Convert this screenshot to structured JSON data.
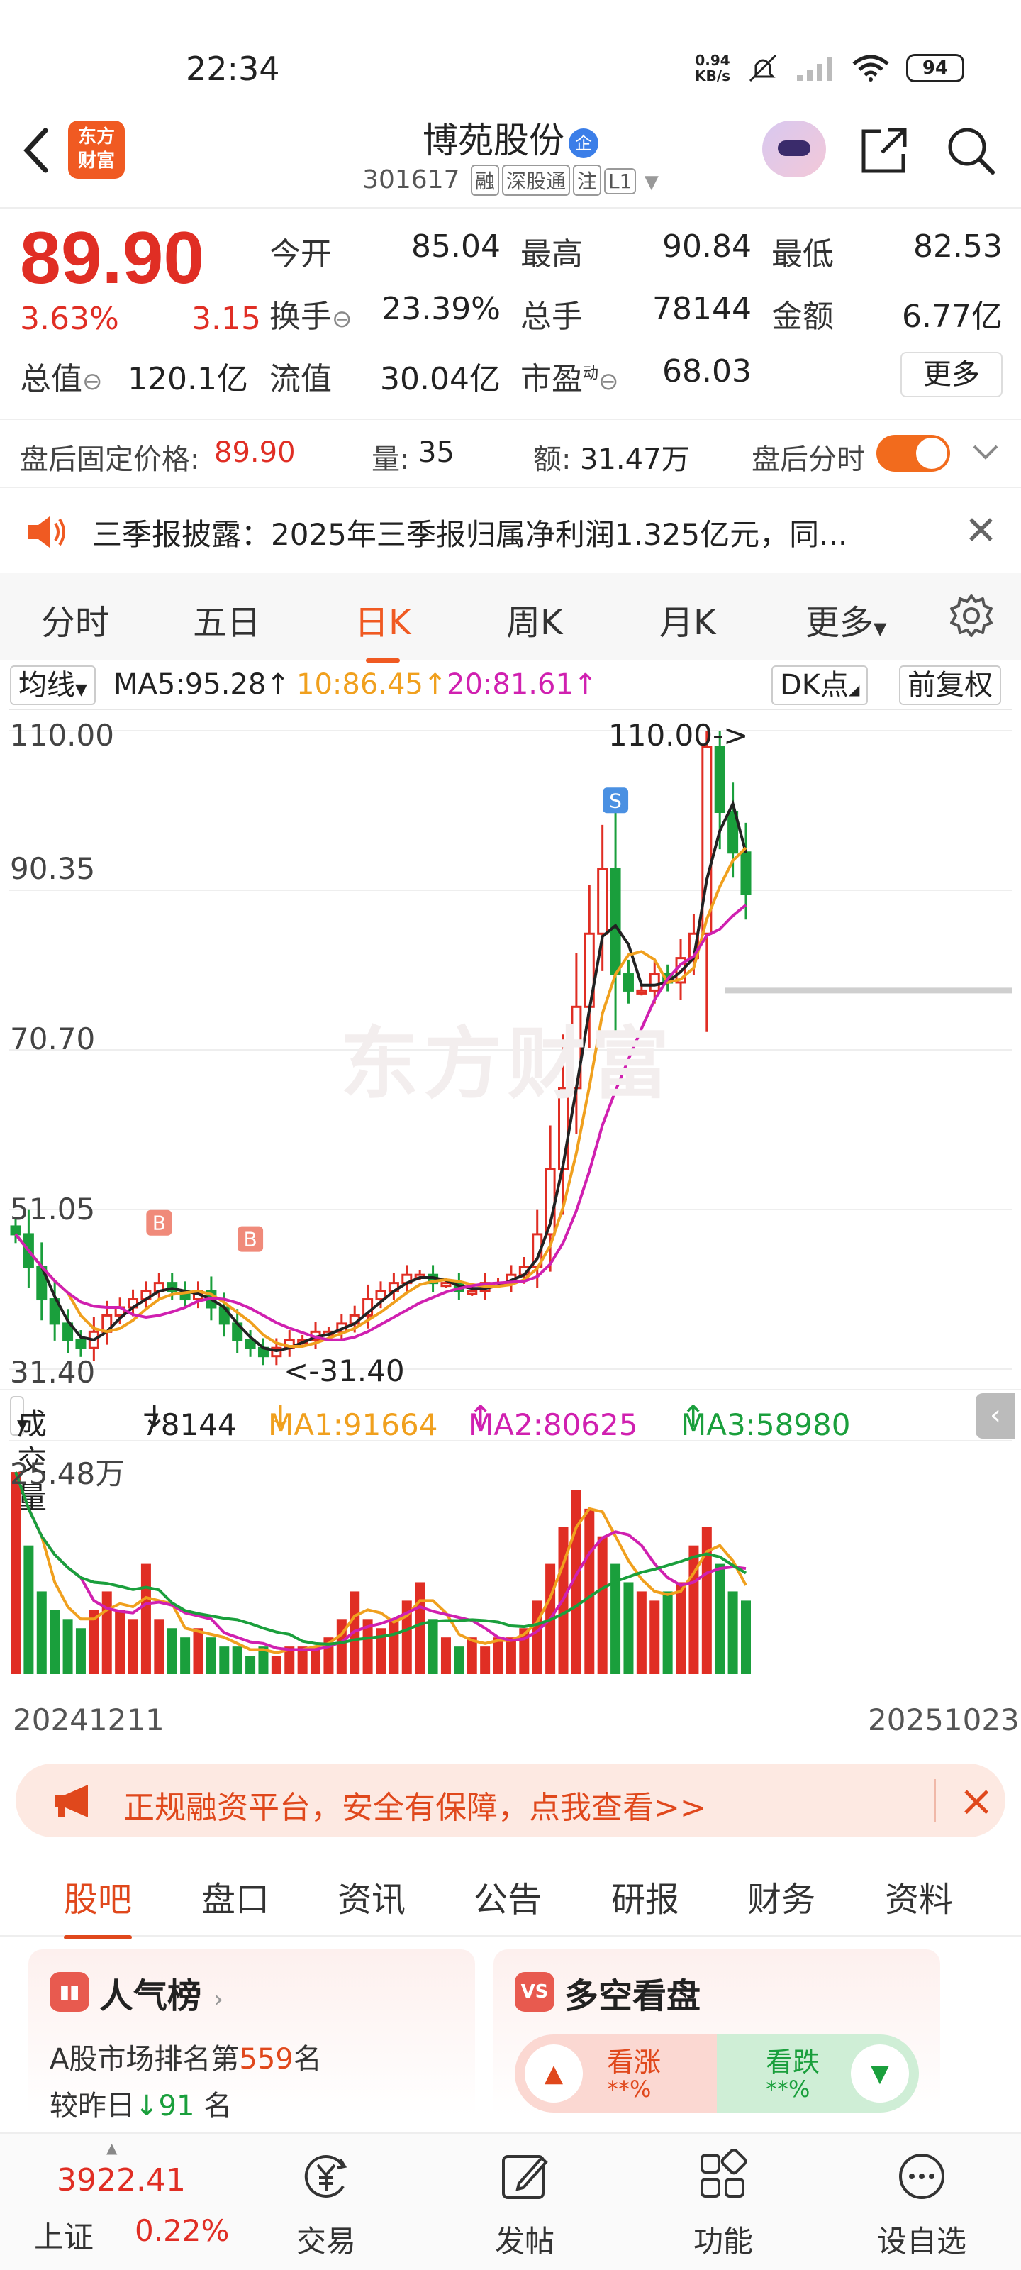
{
  "status_bar": {
    "time": "22:34",
    "net_speed_value": "0.94",
    "net_speed_unit": "KB/s",
    "battery": "94"
  },
  "header": {
    "back_icon": "chevron-left-icon",
    "logo_line1": "东方",
    "logo_line2": "财富",
    "stock_name": "博苑股份",
    "company_badge": "企",
    "stock_code": "301617",
    "tags": [
      "融",
      "深股通",
      "注",
      "L1"
    ]
  },
  "quote": {
    "price": "89.90",
    "change_pct": "3.63%",
    "change_amt": "3.15",
    "fields": [
      {
        "label": "今开",
        "value": "85.04",
        "color": "#1a9f3c"
      },
      {
        "label": "最高",
        "value": "90.84",
        "color": "#e02e24"
      },
      {
        "label": "最低",
        "value": "82.53",
        "color": "#1a9f3c"
      },
      {
        "label": "换手",
        "value": "23.39%",
        "color": "#222222"
      },
      {
        "label": "总手",
        "value": "78144",
        "color": "#222222"
      },
      {
        "label": "金额",
        "value": "6.77亿",
        "color": "#222222"
      },
      {
        "label": "总值",
        "value": "120.1亿",
        "color": "#222222"
      },
      {
        "label": "流值",
        "value": "30.04亿",
        "color": "#222222"
      },
      {
        "label": "市盈",
        "value": "68.03",
        "color": "#222222"
      }
    ],
    "pe_superscript": "动",
    "more_label": "更多"
  },
  "after_hours": {
    "price_label": "盘后固定价格:",
    "price_value": "89.90",
    "vol_label": "量:",
    "vol_value": "35",
    "amt_label": "额:",
    "amt_value": "31.47万",
    "timeshare_label": "盘后分时"
  },
  "notice": {
    "text": "三季报披露：2025年三季报归属净利润1.325亿元，同..."
  },
  "chart_tabs": [
    "分时",
    "五日",
    "日K",
    "周K",
    "月K",
    "更多"
  ],
  "ma": {
    "selector": "均线",
    "ma5": "MA5:95.28",
    "ma10": "10:86.45",
    "ma20": "20:81.61",
    "dk_label": "DK点",
    "adjust_label": "前复权",
    "colors": {
      "ma5": "#222222",
      "ma10": "#f0a01e",
      "ma20": "#d020b0"
    }
  },
  "kchart_labels": {
    "y_top": "110.00",
    "y_2": "90.35",
    "y_3": "70.70",
    "y_4": "51.05",
    "y_bottom": "31.40",
    "high_marker": "110.00->",
    "low_marker": "<-31.40",
    "watermark": "东方财富",
    "signal_b": "B",
    "signal_s": "S"
  },
  "volume": {
    "selector": "成交量",
    "value": "78144",
    "ma1": "MA1:91664",
    "ma2": "MA2:80625",
    "ma3": "MA3:58980",
    "y_top": "25.48万",
    "date_start": "20241211",
    "date_end": "20251023"
  },
  "banner": {
    "text": "正规融资平台，安全有保障，点我查看>>"
  },
  "info_tabs": [
    "股吧",
    "盘口",
    "资讯",
    "公告",
    "研报",
    "财务",
    "资料"
  ],
  "cards": {
    "popularity": {
      "title": "人气榜",
      "rank_prefix": "A股市场排名第",
      "rank": "559",
      "rank_suffix": "名",
      "change_prefix": "较昨日",
      "change": "91",
      "change_suffix": "名"
    },
    "sentiment": {
      "title": "多空看盘",
      "bull": "看涨",
      "bull_pct": "**%",
      "bear": "看跌",
      "bear_pct": "**%"
    }
  },
  "bottom_nav": {
    "index_value": "3922.41",
    "index_name": "上证",
    "index_pct": "0.22%",
    "items": [
      "交易",
      "发帖",
      "功能",
      "设自选"
    ]
  },
  "chart_data": {
    "type": "candlestick",
    "x_range": [
      "20241211",
      "20251023"
    ],
    "ylim": [
      31.4,
      110.0
    ],
    "y_ticks": [
      110.0,
      90.35,
      70.7,
      51.05,
      31.4
    ],
    "period_high": 110.0,
    "period_low": 31.4,
    "last_close": 89.9,
    "ma": {
      "MA5": 95.28,
      "MA10": 86.45,
      "MA20": 81.61
    },
    "close_trend": [
      48,
      44,
      40,
      37,
      35,
      34,
      36,
      38,
      39,
      40,
      41,
      42,
      41,
      40,
      41,
      39,
      37,
      35,
      34,
      33,
      34,
      35,
      35,
      36,
      36,
      37,
      38,
      40,
      41,
      42,
      43,
      43,
      42,
      42,
      41,
      41,
      42,
      42,
      43,
      44,
      48,
      56,
      66,
      76,
      85,
      93,
      80,
      78,
      78,
      80,
      79,
      82,
      85,
      108,
      100,
      95,
      89.9
    ],
    "volume_ylim": [
      0,
      25.48
    ],
    "volume_unit": "万",
    "volume_trend": [
      22,
      14,
      9,
      7,
      6,
      5,
      7,
      9,
      7,
      6,
      12,
      6,
      5,
      4,
      5,
      4,
      3,
      3,
      2,
      3,
      2,
      3,
      3,
      3,
      4,
      6,
      9,
      6,
      5,
      6,
      8,
      10,
      6,
      4,
      3,
      4,
      3,
      4,
      4,
      5,
      8,
      12,
      16,
      20,
      18,
      15,
      12,
      10,
      9,
      8,
      9,
      10,
      14,
      16,
      12,
      9,
      8
    ],
    "volume_ma": {
      "MA1": 91664,
      "MA2": 80625,
      "MA3": 58980
    }
  }
}
